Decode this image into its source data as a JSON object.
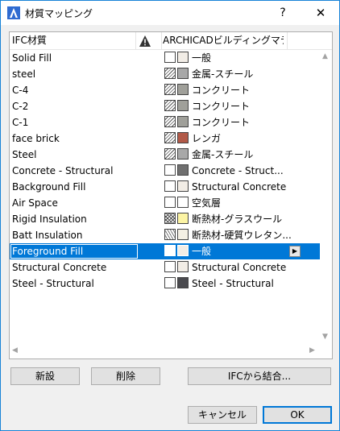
{
  "window": {
    "title": "材質マッピング",
    "help_glyph": "?",
    "close_glyph": "✕"
  },
  "table": {
    "columns": {
      "ifc": "IFC材質",
      "warning_icon": "warning-icon",
      "archicad": "ARCHICADビルディングマテ..."
    },
    "rows": [
      {
        "name": "Solid Fill",
        "pattern": "solid",
        "color": "#f2ede6",
        "material": "一般"
      },
      {
        "name": "steel",
        "pattern": "hatch",
        "color": "#a8a8a8",
        "material": "金属-スチール"
      },
      {
        "name": "C-4",
        "pattern": "hatch",
        "color": "#a0a09a",
        "material": "コンクリート"
      },
      {
        "name": "C-2",
        "pattern": "hatch",
        "color": "#a0a09a",
        "material": "コンクリート"
      },
      {
        "name": "C-1",
        "pattern": "hatch",
        "color": "#a0a09a",
        "material": "コンクリート"
      },
      {
        "name": "face brick",
        "pattern": "hatch",
        "color": "#b25a48",
        "material": "レンガ"
      },
      {
        "name": "Steel",
        "pattern": "hatch",
        "color": "#a8a8a8",
        "material": "金属-スチール"
      },
      {
        "name": "Concrete - Structural",
        "pattern": "solid",
        "color": "#707070",
        "material": "Concrete - Struct..."
      },
      {
        "name": "Background Fill",
        "pattern": "solid",
        "color": "#f2ede6",
        "material": "Structural Concrete"
      },
      {
        "name": "Air Space",
        "pattern": "solid",
        "color": "#ffffff",
        "material": "空気層"
      },
      {
        "name": "Rigid Insulation",
        "pattern": "mesh",
        "color": "#fcf4a4",
        "material": "断熱材-グラスウール"
      },
      {
        "name": "Batt Insulation",
        "pattern": "wave",
        "color": "#f4f0e4",
        "material": "断熱材-硬質ウレタン..."
      },
      {
        "name": "Foreground Fill",
        "pattern": "solid",
        "color": "#f2ede6",
        "material": "一般",
        "selected": true
      },
      {
        "name": "Structural Concrete",
        "pattern": "solid",
        "color": "#f2ede6",
        "material": "Structural Concrete"
      },
      {
        "name": "Steel - Structural",
        "pattern": "solid",
        "color": "#4a4a4e",
        "material": "Steel - Structural"
      }
    ]
  },
  "buttons": {
    "new": "新設",
    "delete": "削除",
    "merge_from_ifc": "IFCから結合...",
    "cancel": "キャンセル",
    "ok": "OK"
  },
  "colors": {
    "selection": "#0078d7",
    "accent_border": "#1883d7"
  }
}
